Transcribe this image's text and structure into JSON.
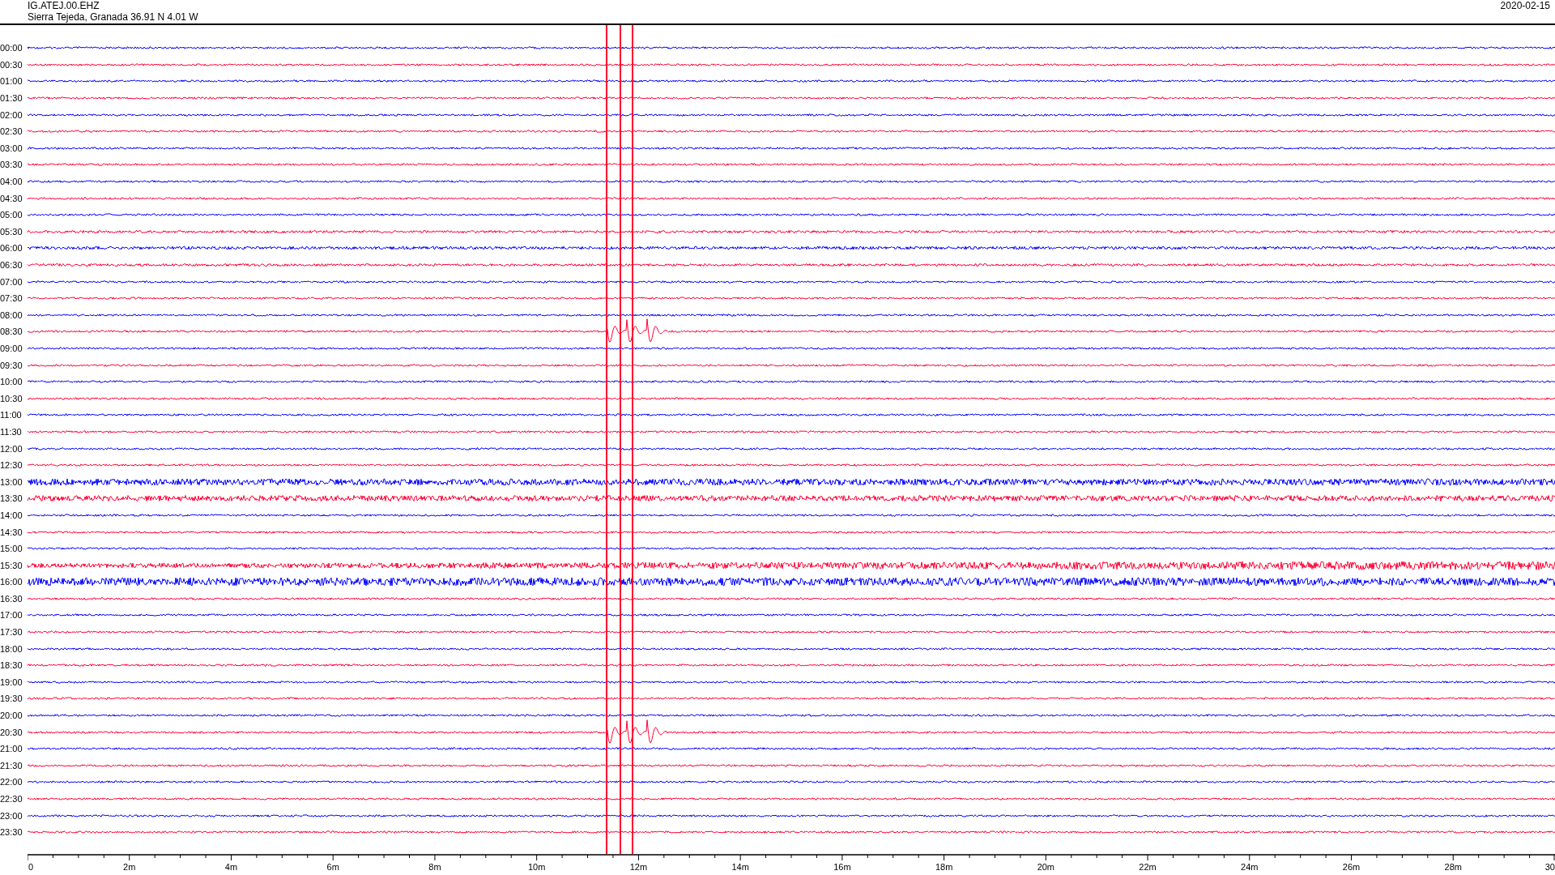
{
  "header": {
    "station": "IG.ATEJ.00.EHZ",
    "location": "Sierra Tejeda, Granada  36.91 N 4.01 W",
    "date": "2020-02-15"
  },
  "rows": [
    {
      "label": "00:00",
      "color": "#0000ff"
    },
    {
      "label": "00:30",
      "color": "#ff0033"
    },
    {
      "label": "01:00",
      "color": "#0000ff"
    },
    {
      "label": "01:30",
      "color": "#ff0033"
    },
    {
      "label": "02:00",
      "color": "#0000ff"
    },
    {
      "label": "02:30",
      "color": "#ff0033"
    },
    {
      "label": "03:00",
      "color": "#0000ff"
    },
    {
      "label": "03:30",
      "color": "#ff0033"
    },
    {
      "label": "04:00",
      "color": "#0000ff"
    },
    {
      "label": "04:30",
      "color": "#ff0033"
    },
    {
      "label": "05:00",
      "color": "#0000ff"
    },
    {
      "label": "05:30",
      "color": "#ff0033"
    },
    {
      "label": "06:00",
      "color": "#0000ff"
    },
    {
      "label": "06:30",
      "color": "#ff0033"
    },
    {
      "label": "07:00",
      "color": "#0000ff"
    },
    {
      "label": "07:30",
      "color": "#ff0033"
    },
    {
      "label": "08:00",
      "color": "#0000ff"
    },
    {
      "label": "08:30",
      "color": "#ff0033"
    },
    {
      "label": "09:00",
      "color": "#0000ff"
    },
    {
      "label": "09:30",
      "color": "#ff0033"
    },
    {
      "label": "10:00",
      "color": "#0000ff"
    },
    {
      "label": "10:30",
      "color": "#ff0033"
    },
    {
      "label": "11:00",
      "color": "#0000ff"
    },
    {
      "label": "11:30",
      "color": "#ff0033"
    },
    {
      "label": "12:00",
      "color": "#0000ff"
    },
    {
      "label": "12:30",
      "color": "#ff0033"
    },
    {
      "label": "13:00",
      "color": "#0000ff"
    },
    {
      "label": "13:30",
      "color": "#ff0033"
    },
    {
      "label": "14:00",
      "color": "#0000ff"
    },
    {
      "label": "14:30",
      "color": "#ff0033"
    },
    {
      "label": "15:00",
      "color": "#0000ff"
    },
    {
      "label": "15:30",
      "color": "#ff0033"
    },
    {
      "label": "16:00",
      "color": "#0000ff"
    },
    {
      "label": "16:30",
      "color": "#ff0033"
    },
    {
      "label": "17:00",
      "color": "#0000ff"
    },
    {
      "label": "17:30",
      "color": "#ff0033"
    },
    {
      "label": "18:00",
      "color": "#0000ff"
    },
    {
      "label": "18:30",
      "color": "#ff0033"
    },
    {
      "label": "19:00",
      "color": "#0000ff"
    },
    {
      "label": "19:30",
      "color": "#ff0033"
    },
    {
      "label": "20:00",
      "color": "#0000ff"
    },
    {
      "label": "20:30",
      "color": "#ff0033"
    },
    {
      "label": "21:00",
      "color": "#0000ff"
    },
    {
      "label": "21:30",
      "color": "#ff0033"
    },
    {
      "label": "22:00",
      "color": "#0000ff"
    },
    {
      "label": "22:30",
      "color": "#ff0033"
    },
    {
      "label": "23:00",
      "color": "#0000ff"
    },
    {
      "label": "23:30",
      "color": "#ff0033"
    }
  ],
  "x_axis": {
    "labels": [
      "0",
      "2m",
      "4m",
      "6m",
      "8m",
      "10m",
      "12m",
      "14m",
      "16m",
      "18m",
      "20m",
      "22m",
      "24m",
      "26m",
      "28m",
      "30"
    ]
  }
}
